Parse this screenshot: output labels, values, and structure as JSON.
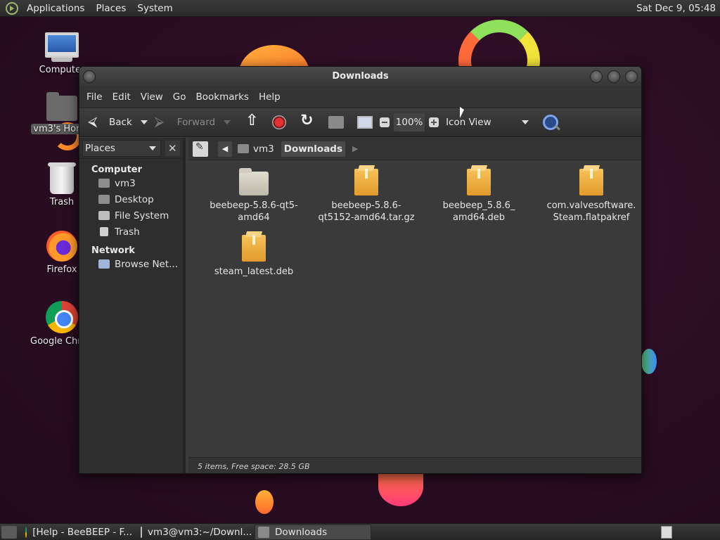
{
  "top_panel": {
    "menus": [
      "Applications",
      "Places",
      "System"
    ],
    "clock": "Sat Dec  9, 05:48"
  },
  "desktop_icons": [
    {
      "label": "Computer",
      "icon": "computer-icon"
    },
    {
      "label": "vm3's Home",
      "icon": "home-folder-icon"
    },
    {
      "label": "Trash",
      "icon": "trash-icon"
    },
    {
      "label": "Firefox",
      "icon": "firefox-icon"
    },
    {
      "label": "Google Chrome",
      "icon": "chrome-icon"
    }
  ],
  "window": {
    "title": "Downloads",
    "menu": [
      "File",
      "Edit",
      "View",
      "Go",
      "Bookmarks",
      "Help"
    ],
    "toolbar": {
      "back": "Back",
      "forward": "Forward",
      "zoom": "100%",
      "view_mode": "Icon View"
    },
    "sidebar": {
      "selector": "Places",
      "close": "✕",
      "sections": [
        {
          "title": "Computer",
          "items": [
            "vm3",
            "Desktop",
            "File System",
            "Trash"
          ]
        },
        {
          "title": "Network",
          "items": [
            "Browse Net..."
          ]
        }
      ]
    },
    "path": [
      "vm3",
      "Downloads"
    ],
    "files": [
      {
        "name": "beebeep-5.8.6-qt5-\namd64",
        "type": "folder"
      },
      {
        "name": "beebeep-5.8.6-\nqt5152-amd64.tar.gz",
        "type": "package"
      },
      {
        "name": "beebeep_5.8.6_\namd64.deb",
        "type": "package"
      },
      {
        "name": "com.valvesoftware.\nSteam.flatpakref",
        "type": "package"
      },
      {
        "name": "steam_latest.deb",
        "type": "package"
      }
    ],
    "status": "5 items, Free space: 28.5 GB"
  },
  "taskbar": {
    "tasks": [
      "[Help - BeeBEEP - F...",
      "vm3@vm3:~/Downl...",
      "Downloads"
    ]
  }
}
